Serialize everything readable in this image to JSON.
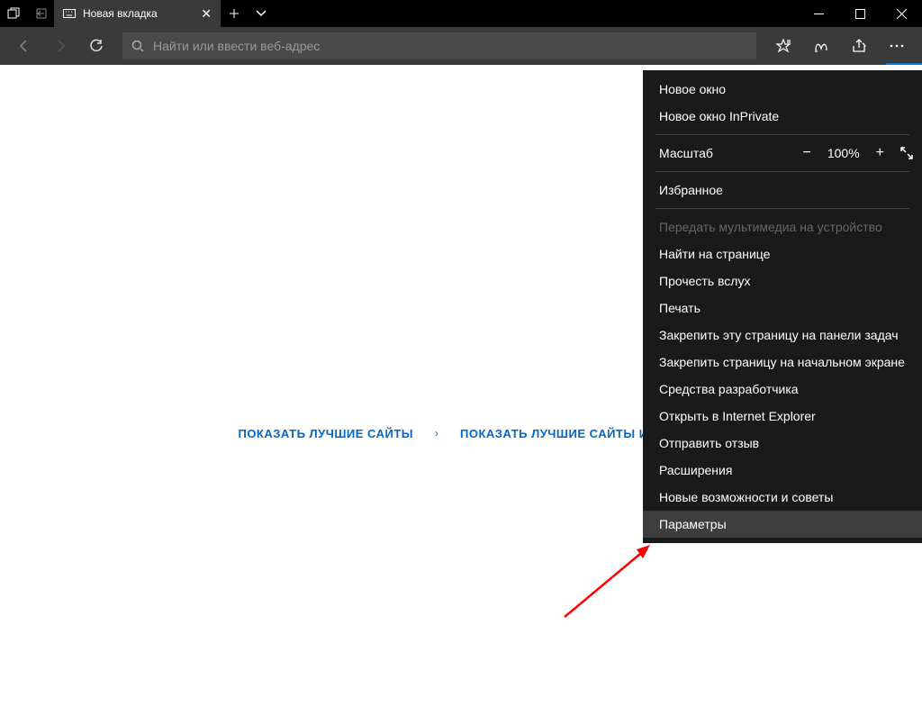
{
  "tab": {
    "title": "Новая вкладка"
  },
  "addressbar": {
    "placeholder": "Найти или ввести веб-адрес"
  },
  "content_links": {
    "top_sites": "ПОКАЗАТЬ ЛУЧШИЕ САЙТЫ",
    "top_sites_and": "ПОКАЗАТЬ ЛУЧШИЕ САЙТЫ И МОЮ"
  },
  "menu": {
    "new_window": "Новое окно",
    "new_inprivate": "Новое окно InPrivate",
    "zoom_label": "Масштаб",
    "zoom_value": "100%",
    "favorites": "Избранное",
    "cast": "Передать мультимедиа на устройство",
    "find": "Найти на странице",
    "read_aloud": "Прочесть вслух",
    "print": "Печать",
    "pin_taskbar": "Закрепить эту страницу на панели задач",
    "pin_start": "Закрепить страницу на начальном экране",
    "devtools": "Средства разработчика",
    "open_ie": "Открыть в Internet Explorer",
    "send_feedback": "Отправить отзыв",
    "extensions": "Расширения",
    "whats_new": "Новые возможности и советы",
    "settings": "Параметры"
  }
}
